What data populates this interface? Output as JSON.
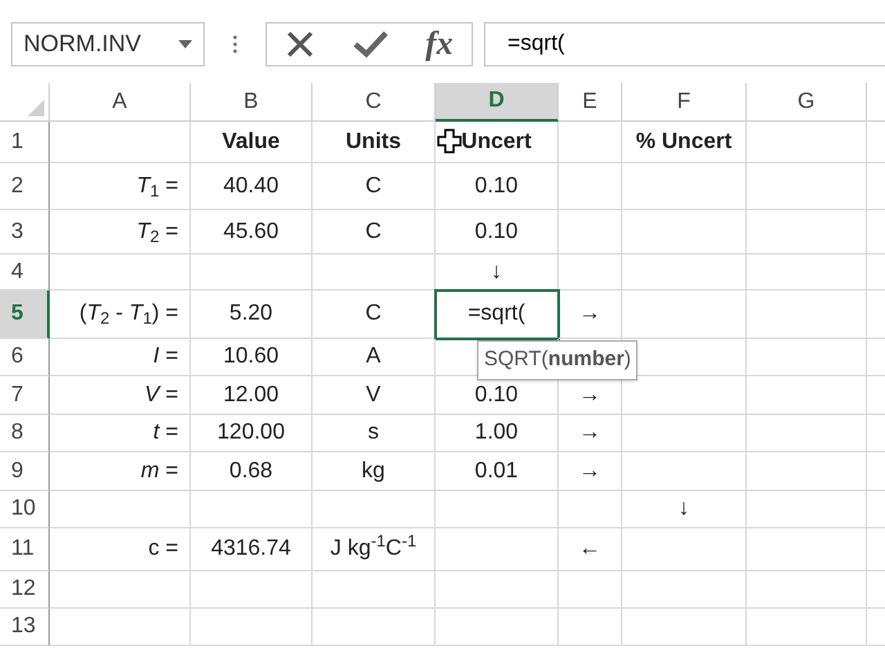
{
  "formula_bar": {
    "name_box": "NORM.INV",
    "insert_function": "fx",
    "formula": "=sqrt("
  },
  "columns": [
    {
      "label": "A",
      "selected": false
    },
    {
      "label": "B",
      "selected": false
    },
    {
      "label": "C",
      "selected": false
    },
    {
      "label": "D",
      "selected": true
    },
    {
      "label": "E",
      "selected": false
    },
    {
      "label": "F",
      "selected": false
    },
    {
      "label": "G",
      "selected": false
    }
  ],
  "rows": [
    {
      "label": "1",
      "selected": false,
      "kind": "header",
      "cells": {
        "B": "Value",
        "C": "Units",
        "D": "Uncert",
        "F": "% Uncert"
      }
    },
    {
      "label": "2",
      "selected": false,
      "kind": "data",
      "cells": {
        "A": "*T*$_{1}$ =",
        "B": "40.40",
        "C": "C",
        "D": "0.10"
      }
    },
    {
      "label": "3",
      "selected": false,
      "kind": "data",
      "cells": {
        "A": "*T*$_{2}$ =",
        "B": "45.60",
        "C": "C",
        "D": "0.10"
      }
    },
    {
      "label": "4",
      "selected": false,
      "kind": "data",
      "cells": {
        "D": "↓"
      }
    },
    {
      "label": "5",
      "selected": true,
      "kind": "data",
      "cells": {
        "A": "(*T*$_{2}$ - *T*$_{1}$) =",
        "B": "5.20",
        "C": "C",
        "D": "=sqrt(",
        "E": "→"
      }
    },
    {
      "label": "6",
      "selected": false,
      "kind": "data",
      "cells": {
        "A": "*I* =",
        "B": "10.60",
        "C": "A"
      }
    },
    {
      "label": "7",
      "selected": false,
      "kind": "data",
      "cells": {
        "A": "*V* =",
        "B": "12.00",
        "C": "V",
        "D": "0.10",
        "E": "→"
      }
    },
    {
      "label": "8",
      "selected": false,
      "kind": "data",
      "cells": {
        "A": "*t* =",
        "B": "120.00",
        "C": "s",
        "D": "1.00",
        "E": "→"
      }
    },
    {
      "label": "9",
      "selected": false,
      "kind": "data",
      "cells": {
        "A": "*m* =",
        "B": "0.68",
        "C": "kg",
        "D": "0.01",
        "E": "→"
      }
    },
    {
      "label": "10",
      "selected": false,
      "kind": "data",
      "cells": {
        "F": "↓"
      }
    },
    {
      "label": "11",
      "selected": false,
      "kind": "data",
      "cells": {
        "A": "c =",
        "B": "4316.74",
        "C": "J kg$^{-1}$C$^{-1}$",
        "E": "←"
      }
    },
    {
      "label": "12",
      "selected": false,
      "kind": "data",
      "cells": {}
    },
    {
      "label": "13",
      "selected": false,
      "kind": "data",
      "cells": {}
    }
  ],
  "tooltip": "SQRT(**number**)"
}
